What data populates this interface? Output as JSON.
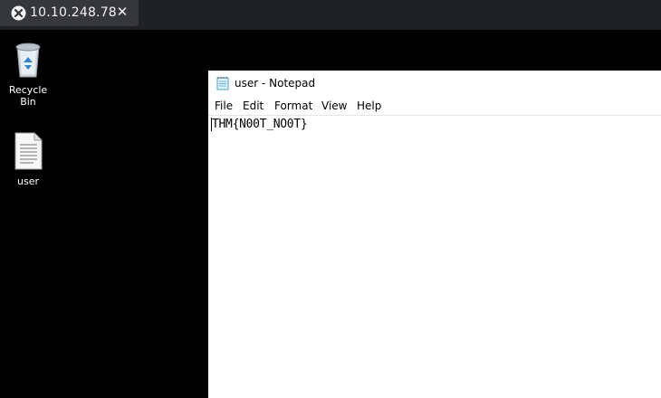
{
  "browser": {
    "tab": {
      "title": "10.10.248.78",
      "close_glyph": "✕"
    }
  },
  "desktop": {
    "icons": [
      {
        "label": "Recycle Bin",
        "icon": "recycle-bin-icon"
      },
      {
        "label": "user",
        "icon": "text-file-icon"
      }
    ]
  },
  "notepad": {
    "title": "user - Notepad",
    "menu": [
      "File",
      "Edit",
      "Format",
      "View",
      "Help"
    ],
    "content": "THM{N00T_NO0T}"
  },
  "colors": {
    "tabbar": "#202124",
    "tab": "#36373a",
    "desktop": "#000000",
    "window": "#ffffff"
  }
}
